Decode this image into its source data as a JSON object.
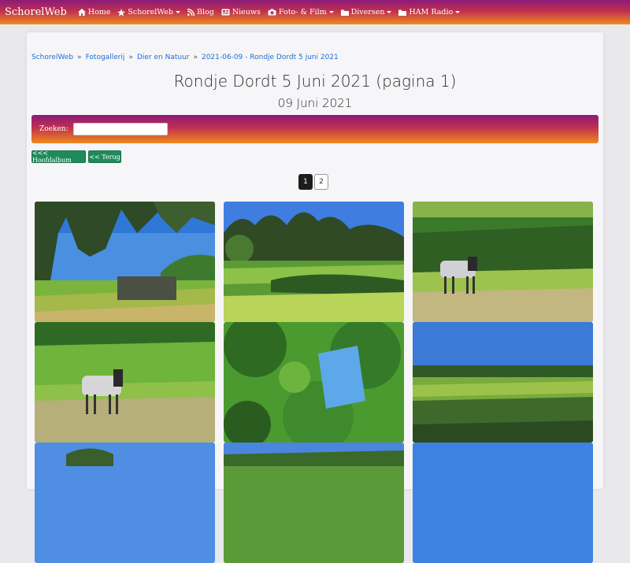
{
  "navbar": {
    "brand": "SchorelWeb",
    "items": [
      {
        "label": "Home",
        "icon": "home-icon",
        "dropdown": false
      },
      {
        "label": "SchorelWeb",
        "icon": "star-icon",
        "dropdown": true
      },
      {
        "label": "Blog",
        "icon": "rss-icon",
        "dropdown": false
      },
      {
        "label": "Nieuws",
        "icon": "newspaper-icon",
        "dropdown": false
      },
      {
        "label": "Foto- & Film",
        "icon": "camera-icon",
        "dropdown": true
      },
      {
        "label": "Diversen",
        "icon": "folder-icon",
        "dropdown": true
      },
      {
        "label": "HAM Radio",
        "icon": "folder-icon",
        "dropdown": true
      }
    ]
  },
  "breadcrumb": [
    "SchorelWeb",
    "Fotogallerij",
    "Dier en Natuur",
    "2021-06-09 - Rondje Dordt 5 juni 2021"
  ],
  "page": {
    "title": "Rondje Dordt 5 Juni 2021 (pagina 1)",
    "date": "09 Juni 2021"
  },
  "search": {
    "label": "Zoeken:",
    "value": ""
  },
  "buttons": {
    "main_album": "<<< Hoofdalbum",
    "back": "<< Terug"
  },
  "pagination": {
    "pages": [
      "1",
      "2"
    ],
    "current": "1"
  },
  "colors": {
    "accent_start": "#8b1a7a",
    "accent_end": "#f08a1c",
    "button": "#1f8a5b",
    "link": "#1e6fd8"
  }
}
